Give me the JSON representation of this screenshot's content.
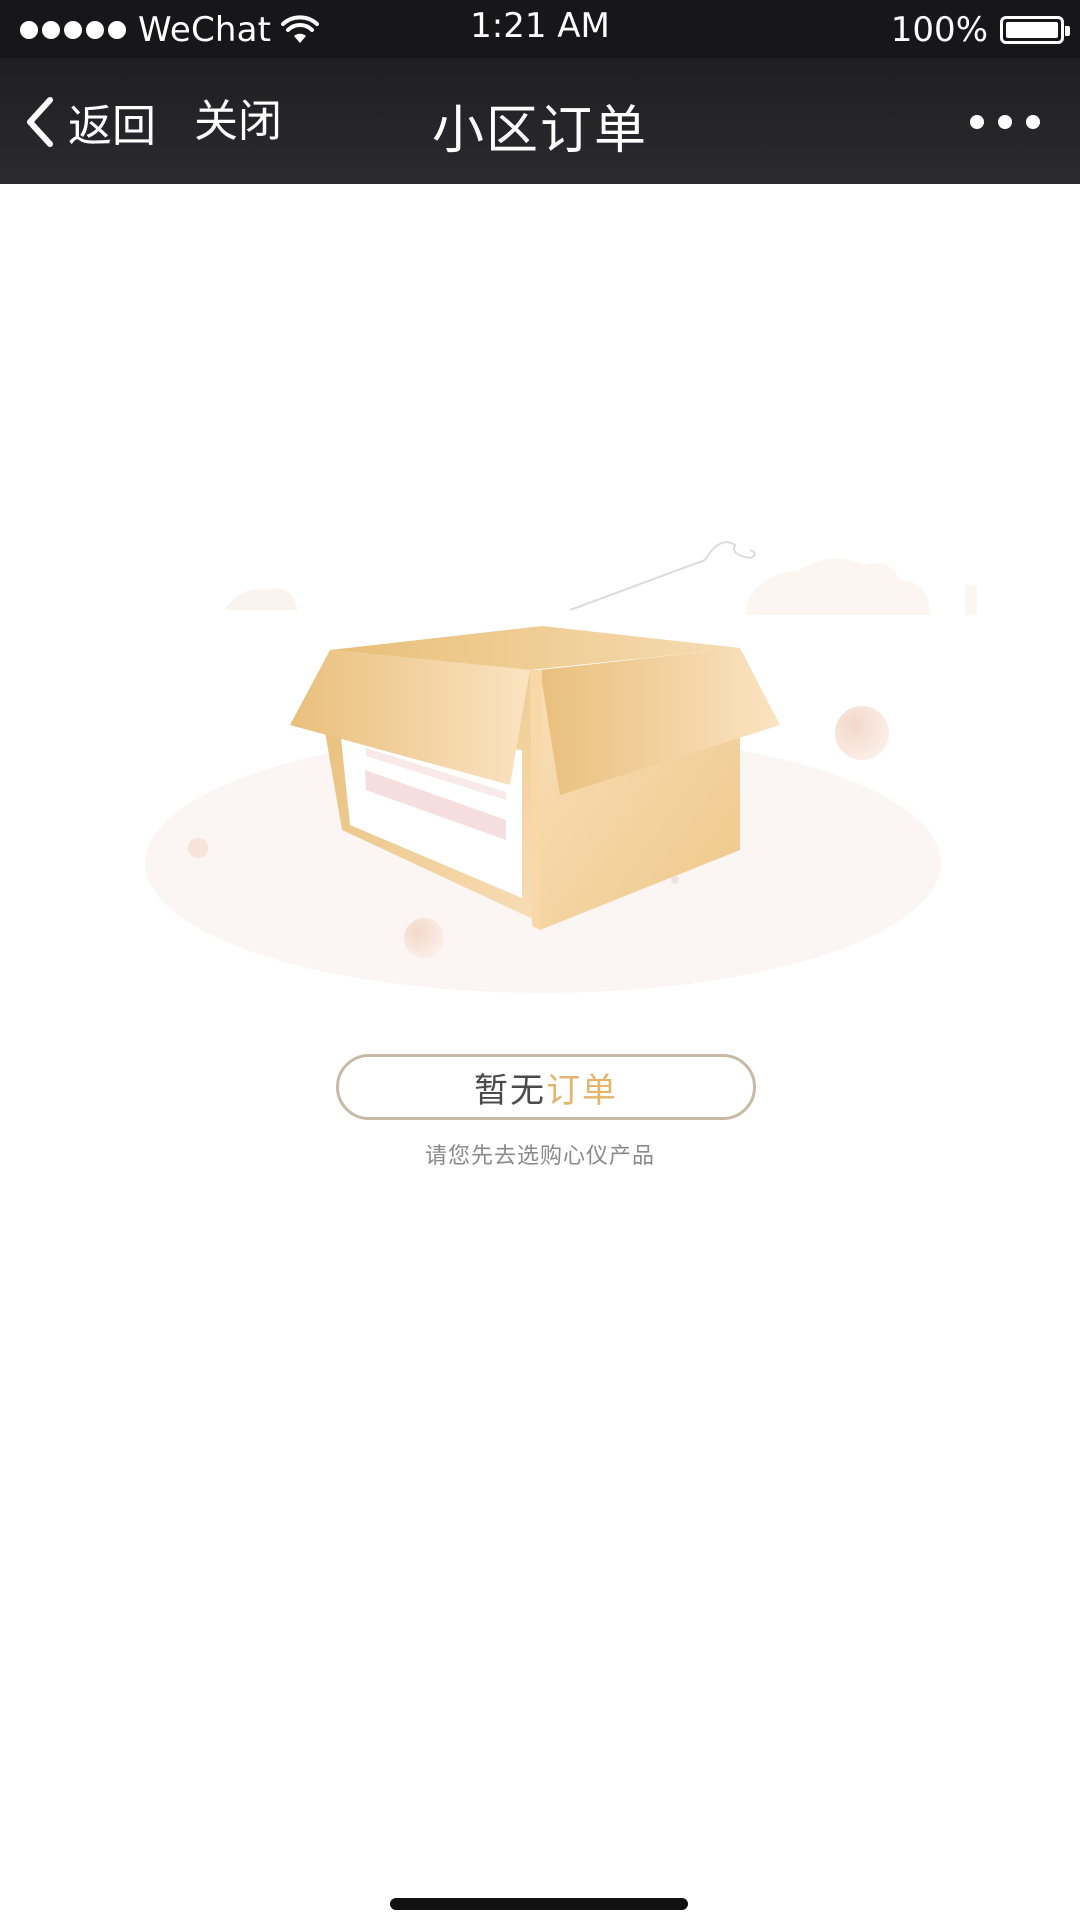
{
  "status_bar": {
    "carrier": "WeChat",
    "time": "1:21 AM",
    "battery_percent": "100%",
    "signal_icon": "signal-dots-icon",
    "wifi_icon": "wifi-icon",
    "battery_icon": "battery-icon"
  },
  "nav": {
    "back_label": "返回",
    "close_label": "关闭",
    "title": "小区订单",
    "back_icon": "chevron-left-icon",
    "more_icon": "more-dots-icon"
  },
  "empty_state": {
    "illustration": "empty-box-illustration",
    "pill_text_gray": "暂无",
    "pill_text_accent": "订单",
    "hint": "请您先去选购心仪产品"
  },
  "colors": {
    "status_bar_bg": "#17171a",
    "nav_bg": "#2b2b2f",
    "accent": "#e5b46a",
    "pill_border": "#c9b9a7",
    "hint_text": "#8a8a8a"
  }
}
